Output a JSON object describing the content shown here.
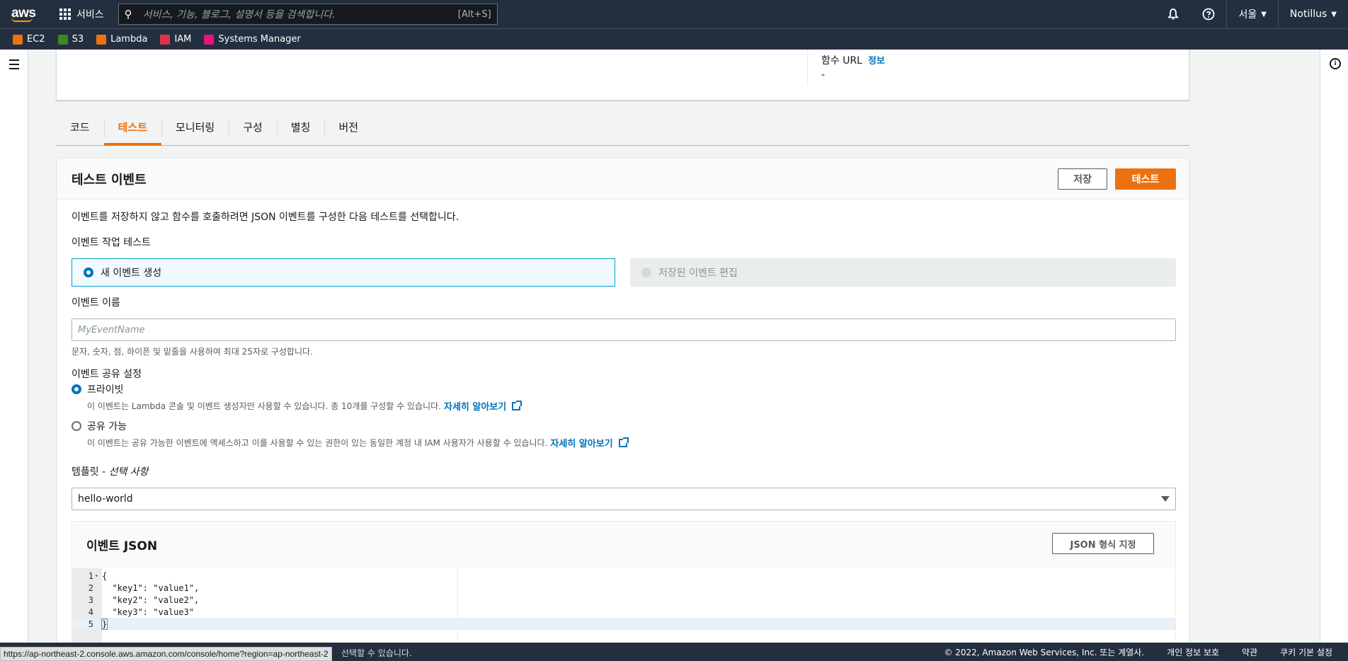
{
  "topnav": {
    "logo": "aws",
    "services_label": "서비스",
    "search_placeholder": "서비스, 기능, 블로그, 설명서 등을 검색합니다.",
    "search_shortcut": "[Alt+S]",
    "region": "서울",
    "account": "Notillus"
  },
  "favorites": [
    {
      "label": "EC2",
      "color": "#ec7211"
    },
    {
      "label": "S3",
      "color": "#3f8624"
    },
    {
      "label": "Lambda",
      "color": "#ec7211"
    },
    {
      "label": "IAM",
      "color": "#dd344c"
    },
    {
      "label": "Systems Manager",
      "color": "#e7157b"
    }
  ],
  "overview": {
    "function_url_label": "함수 URL",
    "info_link": "정보",
    "function_url_value": "-"
  },
  "tabs": [
    {
      "label": "코드",
      "active": false
    },
    {
      "label": "테스트",
      "active": true
    },
    {
      "label": "모니터링",
      "active": false
    },
    {
      "label": "구성",
      "active": false
    },
    {
      "label": "별칭",
      "active": false
    },
    {
      "label": "버전",
      "active": false
    }
  ],
  "test_event": {
    "title": "테스트 이벤트",
    "save_label": "저장",
    "test_label": "테스트",
    "description": "이벤트를 저장하지 않고 함수를 호출하려면 JSON 이벤트를 구성한 다음 테스트를 선택합니다.",
    "action_label": "이벤트 작업 테스트",
    "option_new": "새 이벤트 생성",
    "option_saved": "저장된 이벤트 편집",
    "event_name_label": "이벤트 이름",
    "event_name_placeholder": "MyEventName",
    "event_name_hint": "문자, 숫자, 점, 하이픈 및 밑줄을 사용하여 최대 25자로 구성합니다.",
    "sharing_label": "이벤트 공유 설정",
    "private_label": "프라이빗",
    "private_desc": "이 이벤트는 Lambda 콘솔 및 이벤트 생성자만 사용할 수 있습니다. 총 10개를 구성할 수 있습니다.",
    "shareable_label": "공유 가능",
    "shareable_desc": "이 이벤트는 공유 가능한 이벤트에 액세스하고 이를 사용할 수 있는 권한이 있는 동일한 계정 내 IAM 사용자가 사용할 수 있습니다.",
    "learn_more": "자세히 알아보기",
    "template_label": "템플릿 - ",
    "template_optional": "선택 사항",
    "template_value": "hello-world",
    "json_title": "이벤트 JSON",
    "format_label": "JSON 형식 지정",
    "code_lines": [
      {
        "no": "1",
        "text": "{"
      },
      {
        "no": "2",
        "text": "  \"key1\": \"value1\","
      },
      {
        "no": "3",
        "text": "  \"key2\": \"value2\","
      },
      {
        "no": "4",
        "text": "  \"key3\": \"value3\""
      },
      {
        "no": "5",
        "text": "}"
      }
    ]
  },
  "footer": {
    "partial_note": "선택할 수 있습니다.",
    "copyright": "© 2022, Amazon Web Services, Inc. 또는 계열사.",
    "privacy": "개인 정보 보호",
    "terms": "약관",
    "cookies": "쿠키 기본 설정"
  },
  "status_url": "https://ap-northeast-2.console.aws.amazon.com/console/home?region=ap-northeast-2"
}
